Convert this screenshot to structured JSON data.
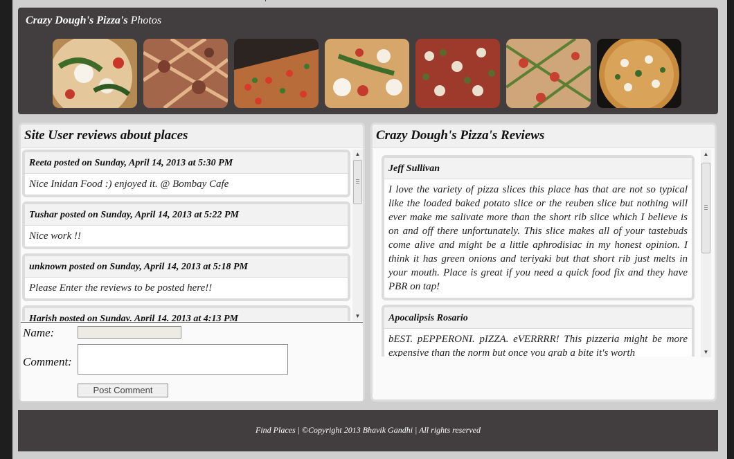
{
  "photos": {
    "title_name": "Crazy Dough's Pizza's",
    "title_suffix": "Photos",
    "items": [
      "pizza-photo-1",
      "pizza-photo-2",
      "pizza-photo-3",
      "pizza-photo-4",
      "pizza-photo-5",
      "pizza-photo-6",
      "pizza-photo-7"
    ]
  },
  "site_reviews": {
    "title": "Site User reviews about places",
    "items": [
      {
        "author": "Reeta posted on Sunday, April 14, 2013 at 5:30 PM",
        "text": "Nice Inidan Food :) enjoyed it. @ Bombay Cafe"
      },
      {
        "author": "Tushar posted on Sunday, April 14, 2013 at 5:22 PM",
        "text": "Nice work !!"
      },
      {
        "author": "unknown posted on Sunday, April 14, 2013 at 5:18 PM",
        "text": "Please Enter the reviews to be posted here!!"
      },
      {
        "author": "Harish posted on Sunday, April 14, 2013 at 4:13 PM",
        "text": ""
      }
    ]
  },
  "form": {
    "name_label": "Name:",
    "name_value": "",
    "comment_label": "Comment:",
    "comment_value": "",
    "post_button": "Post Comment"
  },
  "place_reviews": {
    "title": "Crazy Dough's Pizza's Reviews",
    "items": [
      {
        "author": "Jeff Sullivan",
        "text": "I love the variety of pizza slices this place has that are not so typical like the loaded baked potato slice or the reuben slice but nothing will ever make me salivate more than the short rib slice which I believe is on and off there unfortunately. This slice makes all of your tastebuds come alive and might be a little aphrodisiac in my honest opinion. I think it has green onions and teriyaki but that short rib just melts in your mouth. Place is great if you need a quick food fix and they have PBR on tap!"
      },
      {
        "author": "Apocalipsis Rosario",
        "text": "bEST. pEPPERONI. pIZZA. eVERRRR! This pizzeria might be more expensive than the norm but once you grab a bite it's worth"
      }
    ]
  },
  "footer": {
    "text": "Find Places | ©Copyright 2013 Bhavik Gandhi | All rights reserved"
  }
}
